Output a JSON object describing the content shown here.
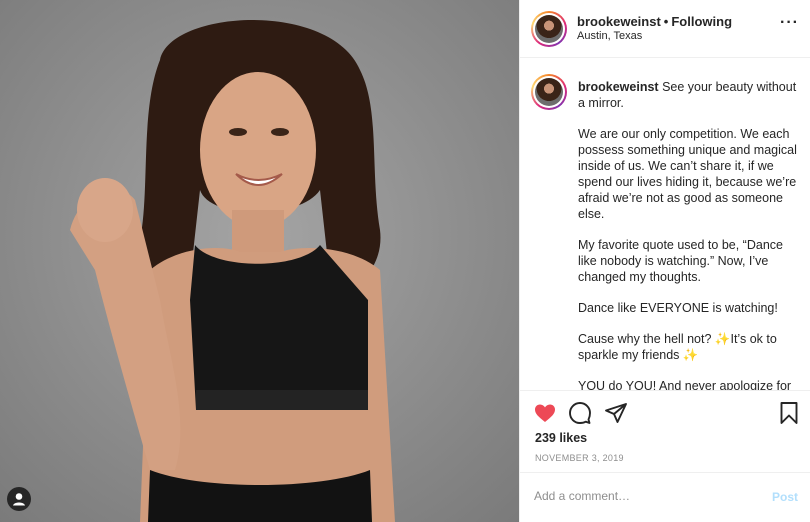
{
  "post": {
    "username": "brookeweinst",
    "separator": "•",
    "follow_status": "Following",
    "location": "Austin, Texas",
    "more_glyph": "···"
  },
  "caption": {
    "username": "brookeweinst",
    "first_line": "See your beauty without a mirror.",
    "paragraphs": [
      "We are our only competition. We each possess something unique and magical inside of us. We can’t share it, if we spend our lives hiding it, because we’re afraid we’re not as good as someone else.",
      "My favorite quote used to be, “Dance like nobody is watching.” Now, I’ve changed my thoughts.",
      "Dance like EVERYONE is watching!",
      "YOU do YOU! And never apologize for that."
    ],
    "sparkle_line": {
      "part1": "Cause why the hell not?",
      "sparkle": "✨",
      "part2": "It’s ok to sparkle my friends"
    }
  },
  "engagement": {
    "likes": "239 likes",
    "date": "NOVEMBER 3, 2019",
    "liked": true
  },
  "comment": {
    "placeholder": "Add a comment…",
    "post_label": "Post"
  },
  "icons": {
    "like": "heart-icon",
    "comment": "comment-icon",
    "share": "share-icon",
    "save": "bookmark-icon",
    "tag": "user-tag-icon"
  },
  "colors": {
    "liked_heart": "#ed4956",
    "post_button_disabled": "#b2dffc",
    "meta_text": "#8e8e8e",
    "photo_background": "#8f8f8f"
  }
}
